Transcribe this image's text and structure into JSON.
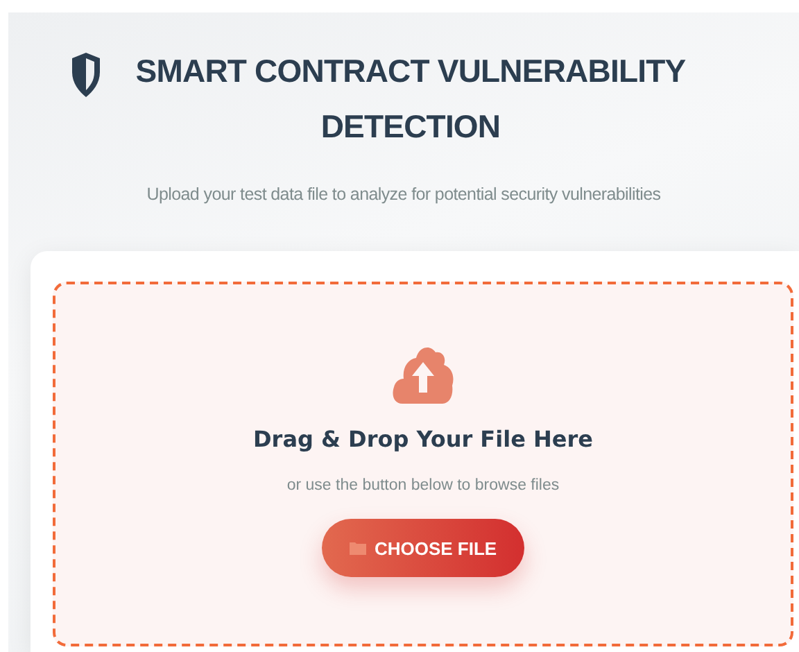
{
  "header": {
    "title": "SMART CONTRACT VULNERABILITY DETECTION",
    "subtitle": "Upload your test data file to analyze for potential security vulnerabilities"
  },
  "dropzone": {
    "heading": "Drag & Drop Your File Here",
    "hint": "or use the button below to browse files",
    "button": "CHOOSE FILE"
  }
}
